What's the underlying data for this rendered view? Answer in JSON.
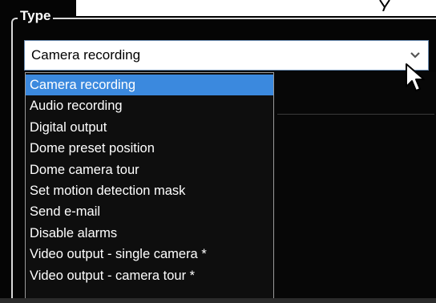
{
  "groupbox": {
    "title": "Type"
  },
  "combo": {
    "selected_value": "Camera recording",
    "dropdown_icon": "chevron-down-icon"
  },
  "dropdown": {
    "items": [
      {
        "label": "Camera recording",
        "selected": true
      },
      {
        "label": "Audio recording",
        "selected": false
      },
      {
        "label": "Digital output",
        "selected": false
      },
      {
        "label": "Dome preset position",
        "selected": false
      },
      {
        "label": "Dome camera tour",
        "selected": false
      },
      {
        "label": "Set motion detection mask",
        "selected": false
      },
      {
        "label": "Send e-mail",
        "selected": false
      },
      {
        "label": "Disable alarms",
        "selected": false
      },
      {
        "label": "Video output - single camera *",
        "selected": false
      },
      {
        "label": "Video output - camera tour *",
        "selected": false
      }
    ]
  },
  "colors": {
    "selection": "#3b89de",
    "combo_border": "#6d8fb4",
    "background": "#050505"
  }
}
